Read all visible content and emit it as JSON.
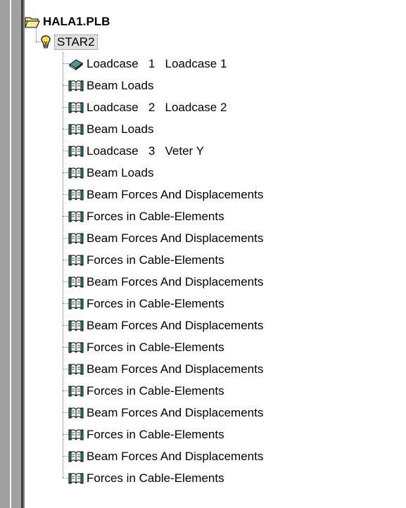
{
  "tree": {
    "root": {
      "label": "HALA1.PLB",
      "icon": "folder-open-icon"
    },
    "model": {
      "label": "STAR2",
      "icon": "lightbulb-icon"
    },
    "items": [
      {
        "label": "Loadcase   1   Loadcase 1",
        "icon": "closed-book-icon"
      },
      {
        "label": "Beam Loads",
        "icon": "open-book-icon"
      },
      {
        "label": "Loadcase   2   Loadcase 2",
        "icon": "open-book-icon"
      },
      {
        "label": "Beam Loads",
        "icon": "open-book-icon"
      },
      {
        "label": "Loadcase   3   Veter Y",
        "icon": "open-book-icon"
      },
      {
        "label": "Beam Loads",
        "icon": "open-book-icon"
      },
      {
        "label": "Beam Forces And Displacements",
        "icon": "open-book-icon"
      },
      {
        "label": "Forces in Cable-Elements",
        "icon": "open-book-icon"
      },
      {
        "label": "Beam Forces And Displacements",
        "icon": "open-book-icon"
      },
      {
        "label": "Forces in Cable-Elements",
        "icon": "open-book-icon"
      },
      {
        "label": "Beam Forces And Displacements",
        "icon": "open-book-icon"
      },
      {
        "label": "Forces in Cable-Elements",
        "icon": "open-book-icon"
      },
      {
        "label": "Beam Forces And Displacements",
        "icon": "open-book-icon"
      },
      {
        "label": "Forces in Cable-Elements",
        "icon": "open-book-icon"
      },
      {
        "label": "Beam Forces And Displacements",
        "icon": "open-book-icon"
      },
      {
        "label": "Forces in Cable-Elements",
        "icon": "open-book-icon"
      },
      {
        "label": "Beam Forces And Displacements",
        "icon": "open-book-icon"
      },
      {
        "label": "Forces in Cable-Elements",
        "icon": "open-book-icon"
      },
      {
        "label": "Beam Forces And Displacements",
        "icon": "open-book-icon"
      },
      {
        "label": "Forces in Cable-Elements",
        "icon": "open-book-icon"
      }
    ]
  }
}
